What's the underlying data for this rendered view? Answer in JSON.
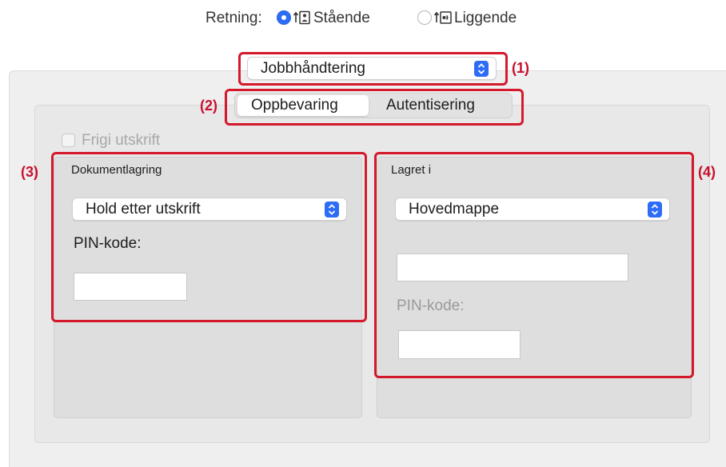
{
  "orientation": {
    "label": "Retning:",
    "options": [
      {
        "label": "Stående",
        "selected": true,
        "icon": "portrait-orientation-icon"
      },
      {
        "label": "Liggende",
        "selected": false,
        "icon": "landscape-orientation-icon"
      }
    ]
  },
  "panel_popup": {
    "value": "Jobbhåndtering"
  },
  "tabs": [
    {
      "label": "Oppbevaring",
      "selected": true
    },
    {
      "label": "Autentisering",
      "selected": false
    }
  ],
  "release_print": {
    "label": "Frigi utskrift",
    "checked": false,
    "enabled": false
  },
  "document_filing": {
    "title": "Dokumentlagring",
    "mode_value": "Hold etter utskrift",
    "pin_label": "PIN-kode:",
    "pin_value": ""
  },
  "stored_in": {
    "title": "Lagret i",
    "folder_value": "Hovedmappe",
    "folder_name_value": "",
    "pin_label": "PIN-kode:",
    "pin_value": ""
  },
  "callouts": [
    "(1)",
    "(2)",
    "(3)",
    "(4)"
  ],
  "colors": {
    "accent": "#2d6df6",
    "callout_red": "#d3192b"
  }
}
